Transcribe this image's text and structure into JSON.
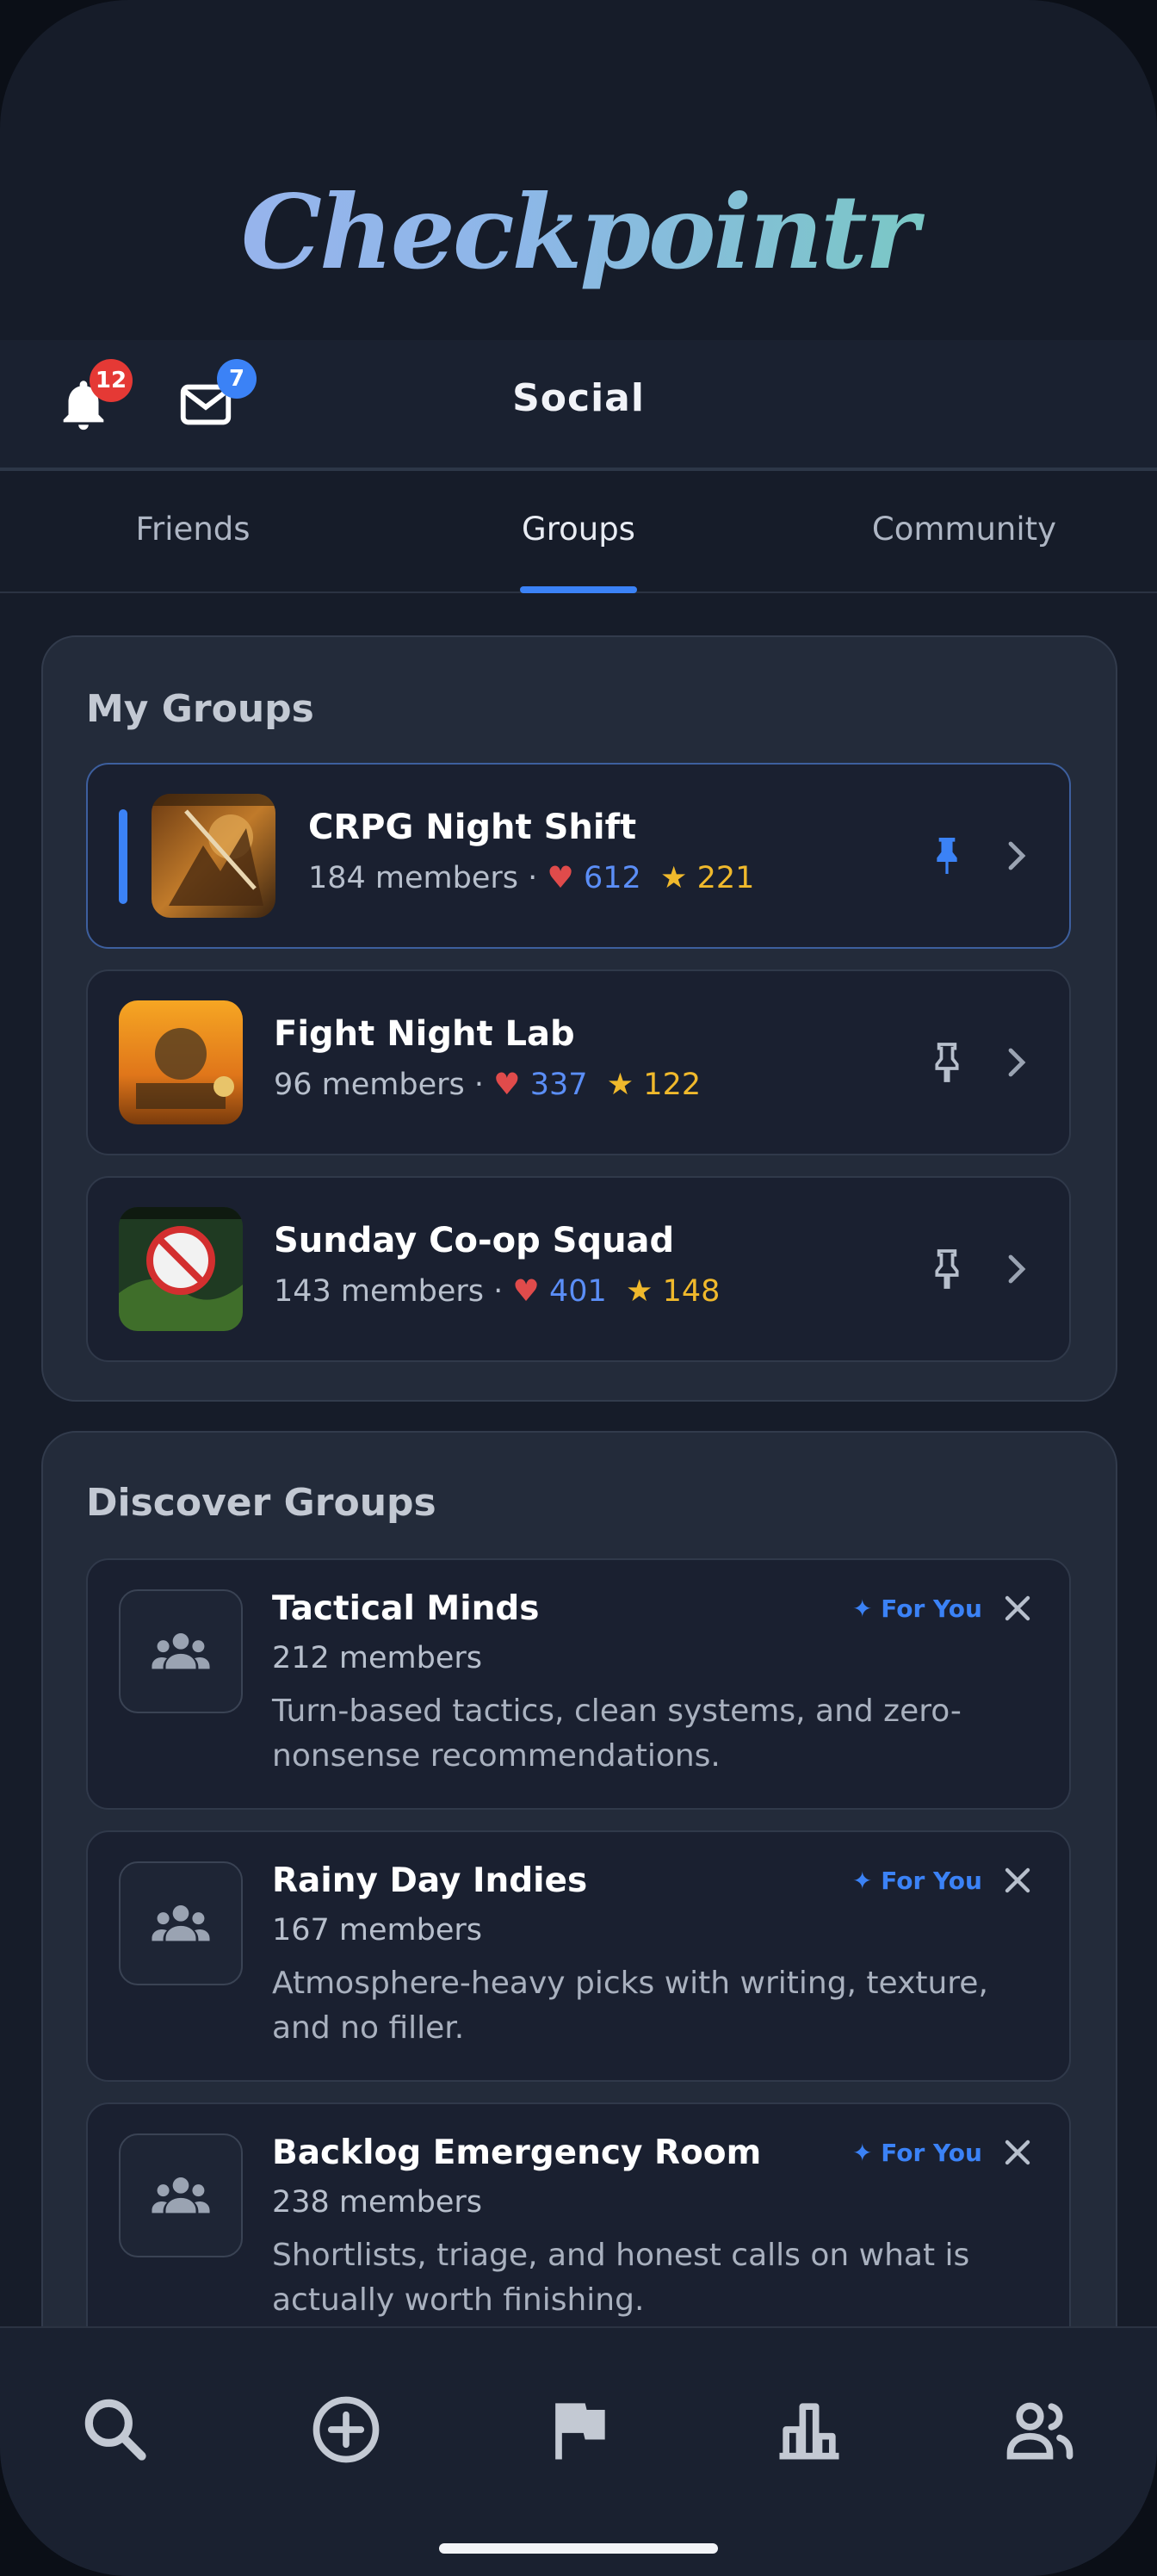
{
  "app": {
    "logo_text": "Checkpointr"
  },
  "header": {
    "title": "Social",
    "notifications_badge": "12",
    "messages_badge": "7",
    "notifications_icon": "bell-icon",
    "messages_icon": "mail-icon"
  },
  "tabs": [
    {
      "label": "Friends",
      "active": false
    },
    {
      "label": "Groups",
      "active": true
    },
    {
      "label": "Community",
      "active": false
    }
  ],
  "my_groups": {
    "title": "My Groups",
    "items": [
      {
        "name": "CRPG Night Shift",
        "members": "184 members",
        "likes": "612",
        "stars": "221",
        "pinned": true
      },
      {
        "name": "Fight Night Lab",
        "members": "96 members",
        "likes": "337",
        "stars": "122",
        "pinned": false
      },
      {
        "name": "Sunday Co-op Squad",
        "members": "143 members",
        "likes": "401",
        "stars": "148",
        "pinned": false
      }
    ]
  },
  "discover": {
    "title": "Discover Groups",
    "for_you_label": "For You",
    "items": [
      {
        "name": "Tactical Minds",
        "members": "212 members",
        "desc": "Turn-based tactics, clean systems, and zero-nonsense recommendations."
      },
      {
        "name": "Rainy Day Indies",
        "members": "167 members",
        "desc": "Atmosphere-heavy picks with writing, texture, and no filler."
      },
      {
        "name": "Backlog Emergency Room",
        "members": "238 members",
        "desc": "Shortlists, triage, and honest calls on what is actually worth finishing."
      }
    ]
  },
  "colors": {
    "accent": "#3b82f6",
    "like": "#e04b4b",
    "star": "#f0b92c",
    "badge_red": "#e53935",
    "badge_blue": "#3b82f6"
  },
  "bottom_nav": [
    "search-icon",
    "add-circle-icon",
    "flag-icon",
    "leaderboard-icon",
    "people-icon"
  ]
}
